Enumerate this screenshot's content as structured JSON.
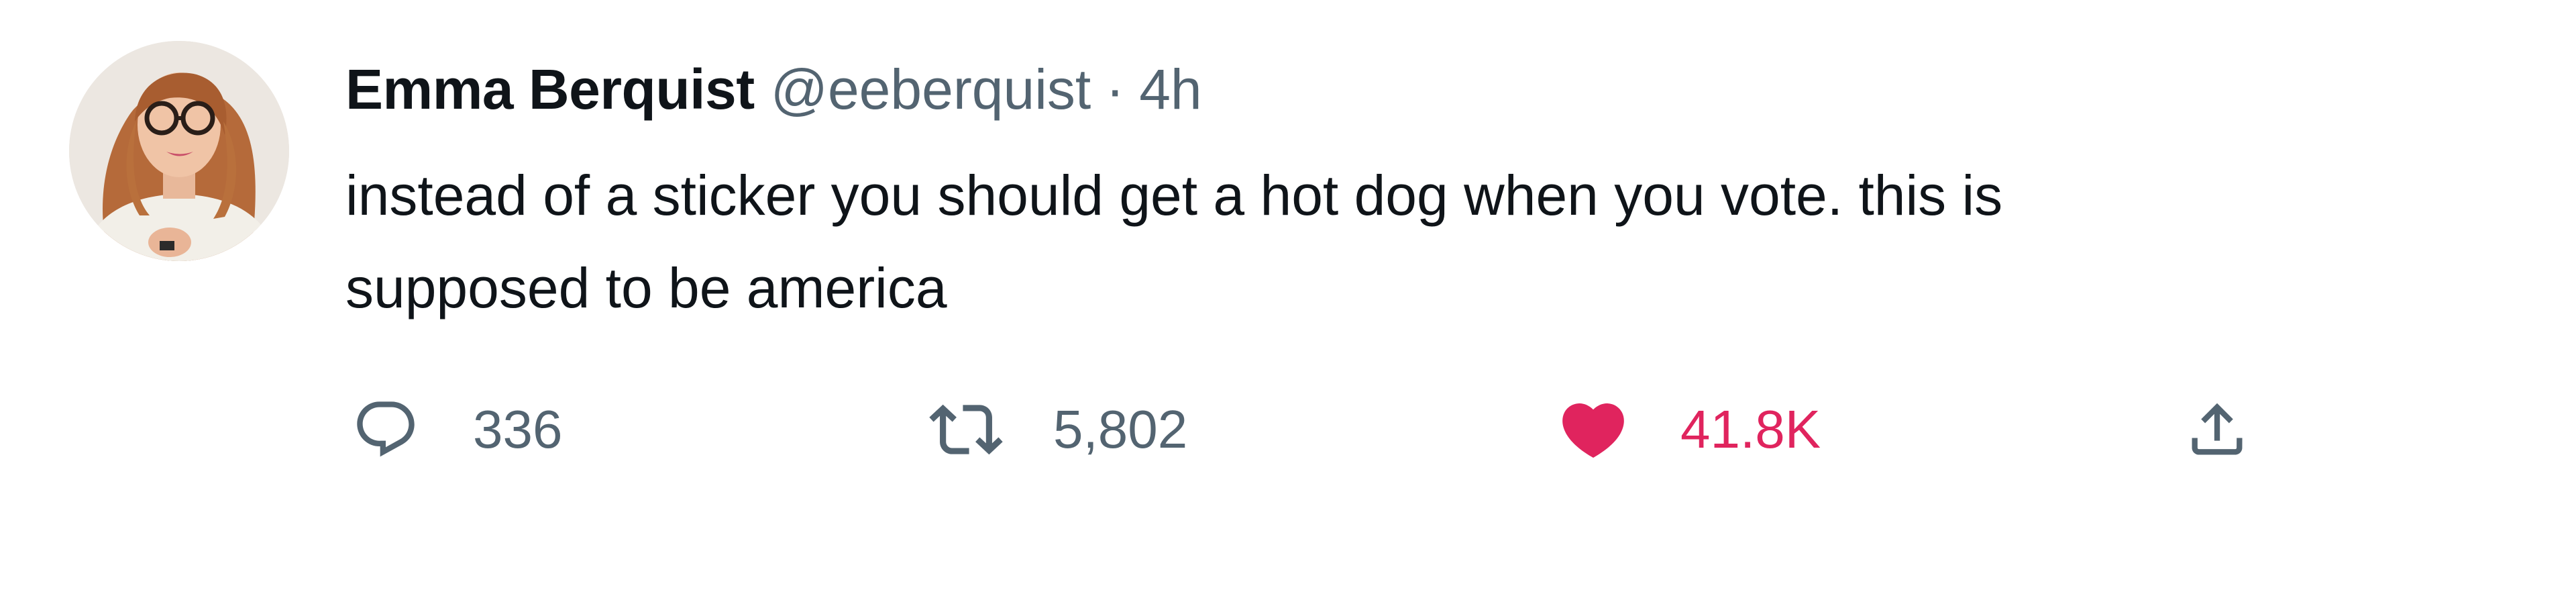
{
  "tweet": {
    "display_name": "Emma Berquist",
    "handle": "@eeberquist",
    "separator": "·",
    "time": "4h",
    "text": "instead of a sticker you should get a hot dog when you vote. this is\nsupposed to be america",
    "avatar_icon": "profile-photo"
  },
  "actions": {
    "reply": {
      "icon": "reply-icon",
      "count": "336"
    },
    "retweet": {
      "icon": "retweet-icon",
      "count": "5,802"
    },
    "like": {
      "icon": "heart-icon",
      "count": "41.8K",
      "liked": true
    },
    "share": {
      "icon": "share-icon"
    }
  },
  "colors": {
    "text_primary": "#0f1419",
    "text_secondary": "#536471",
    "like_active": "#e0245e",
    "background": "#ffffff"
  }
}
